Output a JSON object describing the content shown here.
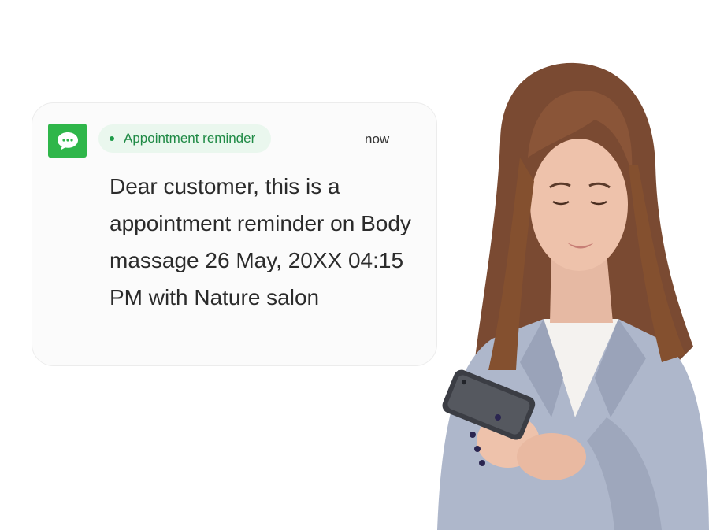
{
  "notification": {
    "app_icon": "message-bubble-icon",
    "badge_label": "Appointment reminder",
    "time": "now",
    "message": "Dear customer, this is a appointment reminder on Body massage 26 May, 20XX 04:15 PM with Nature salon"
  },
  "colors": {
    "app_icon_bg": "#2fb64a",
    "badge_bg": "#eaf7ee",
    "badge_text": "#1f8a45",
    "message_text": "#2b2b2b"
  },
  "photo": {
    "subject": "woman-using-smartphone-photo"
  }
}
